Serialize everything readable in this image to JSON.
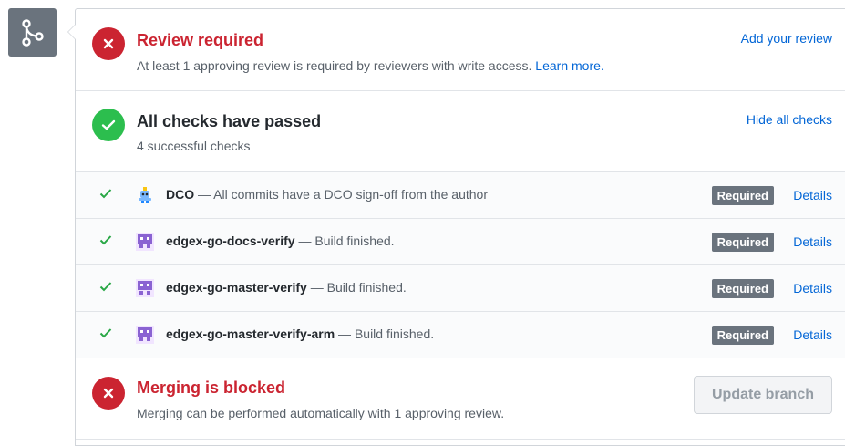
{
  "review": {
    "title": "Review required",
    "description": "At least 1 approving review is required by reviewers with write access.",
    "learn_more": "Learn more.",
    "action": "Add your review",
    "color": "#cb2431"
  },
  "checks": {
    "title": "All checks have passed",
    "subtitle": "4 successful checks",
    "toggle": "Hide all checks",
    "color": "#2cbe4e",
    "items": [
      {
        "name": "DCO",
        "description": " — All commits have a DCO sign-off from the author",
        "badge": "Required",
        "details": "Details",
        "avatar": "robot-icon"
      },
      {
        "name": "edgex-go-docs-verify",
        "description": " — Build finished.",
        "badge": "Required",
        "details": "Details",
        "avatar": "pixel-avatar-icon"
      },
      {
        "name": "edgex-go-master-verify",
        "description": " — Build finished.",
        "badge": "Required",
        "details": "Details",
        "avatar": "pixel-avatar-icon"
      },
      {
        "name": "edgex-go-master-verify-arm",
        "description": " — Build finished.",
        "badge": "Required",
        "details": "Details",
        "avatar": "pixel-avatar-icon"
      }
    ]
  },
  "merge": {
    "title": "Merging is blocked",
    "description": "Merging can be performed automatically with 1 approving review.",
    "button": "Update branch",
    "color": "#cb2431"
  }
}
